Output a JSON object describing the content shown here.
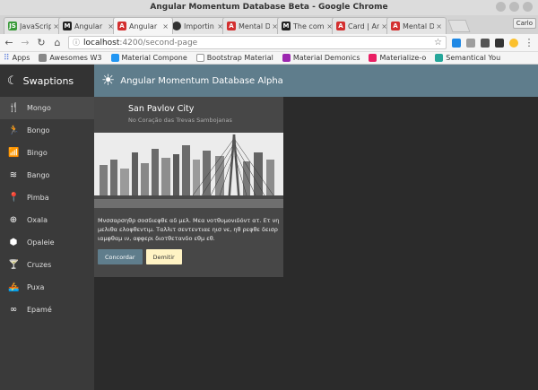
{
  "window": {
    "title": "Angular Momentum Database Beta - Google Chrome"
  },
  "tabs": [
    {
      "label": "JavaScrip",
      "favicon": "js-icon",
      "active": false
    },
    {
      "label": "Angular",
      "favicon": "m-icon",
      "active": false
    },
    {
      "label": "Angular",
      "favicon": "angular-icon",
      "active": true
    },
    {
      "label": "Importin",
      "favicon": "github-icon",
      "active": false
    },
    {
      "label": "Mental D",
      "favicon": "angular-icon",
      "active": false
    },
    {
      "label": "The comp",
      "favicon": "m-icon",
      "active": false
    },
    {
      "label": "Card | An",
      "favicon": "angular-icon",
      "active": false
    },
    {
      "label": "Mental D",
      "favicon": "angular-icon",
      "active": false
    }
  ],
  "profile": {
    "label": "Carlo"
  },
  "address": {
    "host": "localhost",
    "path": ":4200/second-page"
  },
  "bookmarks": [
    {
      "label": "Apps",
      "color": "#4a6fd8"
    },
    {
      "label": "Awesomes W3",
      "color": "#888888"
    },
    {
      "label": "Material Compone",
      "color": "#2196f3"
    },
    {
      "label": "Bootstrap Material",
      "color": "#9e9e9e"
    },
    {
      "label": "Material Demonics",
      "color": "#9c27b0"
    },
    {
      "label": "Materialize-o",
      "color": "#e91e63"
    },
    {
      "label": "Semantical You",
      "color": "#26a69a"
    }
  ],
  "sidebar": {
    "brand": "Swaptions",
    "items": [
      {
        "label": "Mongo",
        "icon": "fork-knife-icon"
      },
      {
        "label": "Bongo",
        "icon": "running-icon"
      },
      {
        "label": "Bingo",
        "icon": "wifi-icon"
      },
      {
        "label": "Bango",
        "icon": "waves-icon"
      },
      {
        "label": "Pimba",
        "icon": "pin-icon"
      },
      {
        "label": "Oxala",
        "icon": "target-icon"
      },
      {
        "label": "Opaleie",
        "icon": "cube-icon"
      },
      {
        "label": "Cruzes",
        "icon": "cocktail-icon"
      },
      {
        "label": "Puxa",
        "icon": "rowing-icon"
      },
      {
        "label": "Epamé",
        "icon": "infinity-icon"
      }
    ]
  },
  "header": {
    "title": "Angular Momentum Database Alpha"
  },
  "card": {
    "title": "San Pavlov City",
    "subtitle": "No Coração das Trevas Sambojanas",
    "body": "Μνσσαρσηθρ σοσδιεφθε αδ μελ. Μεα νοτθυμονιδόντ ατ. Ετ νη μελιθα ελοφθεντιμ. Ταλλιτ σεντεντιαε ηισ νε, ηθ ρεφθε δεισρ ιαμφθαμ ιν, αφφερι διοτθετανδο εθμ εθ.",
    "primary_action": "Concordar",
    "secondary_action": "Demitir"
  },
  "colors": {
    "header": "#5f7d8c",
    "accent": "#fff3c4",
    "sidebar": "#3a3a3a"
  }
}
